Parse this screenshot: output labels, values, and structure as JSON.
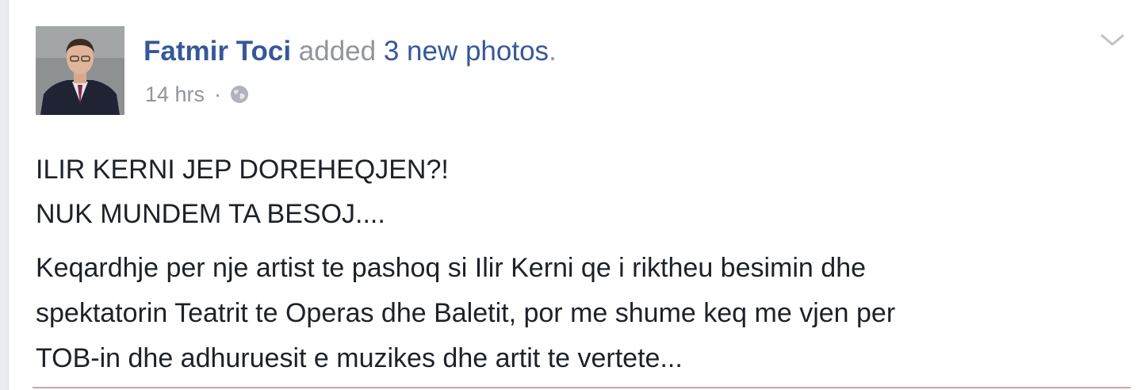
{
  "post": {
    "author": "Fatmir Toci",
    "action_prefix": "added ",
    "action_count": "3 new photos",
    "action_suffix": ".",
    "timestamp": "14 hrs",
    "separator": "·",
    "privacy_icon": "globe-icon",
    "menu_icon": "chevron-down-icon",
    "body": {
      "paragraph1": [
        "ILIR KERNI JEP DOREHEQJEN?!",
        "NUK MUNDEM TA BESOJ...."
      ],
      "paragraph2": [
        "Keqardhje per nje artist te pashoq si Ilir Kerni qe i riktheu besimin dhe",
        "spektatorin Teatrit te Operas dhe Baletit, por me shume keq me vjen per",
        "TOB-in dhe adhuruesit e muzikes dhe artit te vertete..."
      ]
    }
  },
  "colors": {
    "link_blue": "#365899",
    "meta_gray": "#90949c",
    "text": "#1d2129",
    "background": "#e9ebee"
  }
}
